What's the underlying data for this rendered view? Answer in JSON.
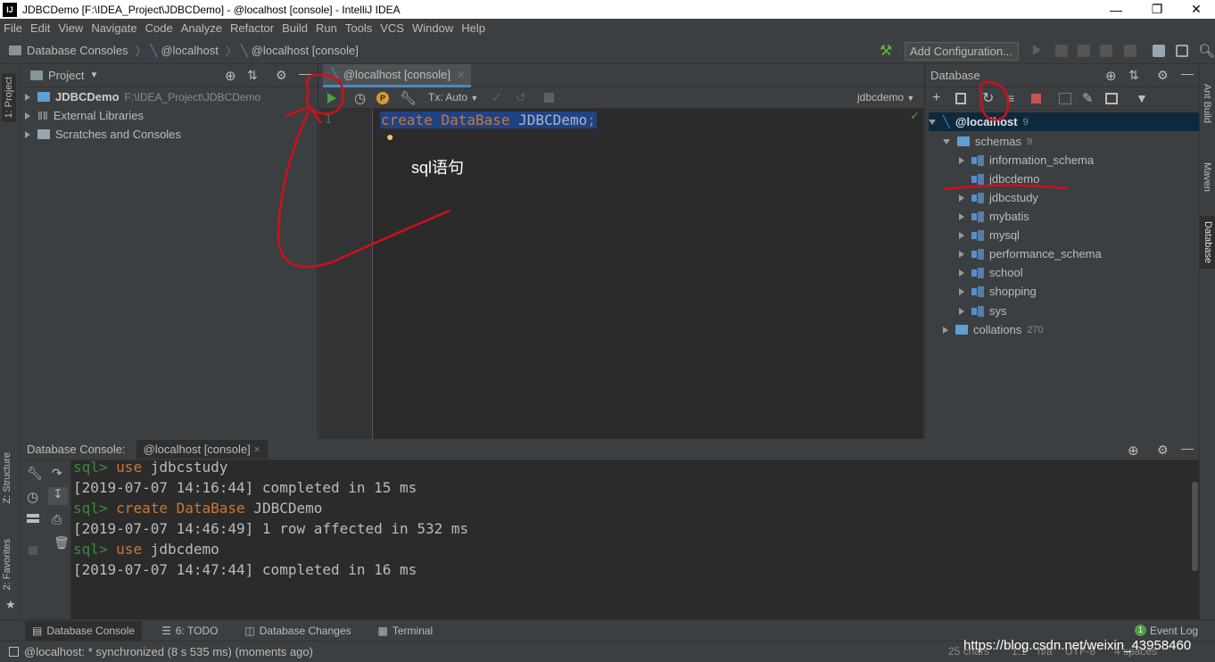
{
  "window": {
    "title": "JDBCDemo [F:\\IDEA_Project\\JDBCDemo] - @localhost [console] - IntelliJ IDEA",
    "app_icon": "IJ"
  },
  "menu": [
    "File",
    "Edit",
    "View",
    "Navigate",
    "Code",
    "Analyze",
    "Refactor",
    "Build",
    "Run",
    "Tools",
    "VCS",
    "Window",
    "Help"
  ],
  "breadcrumb": [
    "Database Consoles",
    "@localhost",
    "@localhost [console]"
  ],
  "toolbar": {
    "add_config": "Add Configuration..."
  },
  "left_tabs": {
    "project": "1: Project",
    "structure": "Z: Structure",
    "favorites": "2: Favorites"
  },
  "right_tabs": {
    "ant": "Ant Build",
    "maven": "Maven",
    "database": "Database"
  },
  "project_panel": {
    "title": "Project",
    "items": [
      {
        "label": "JDBCDemo",
        "path": "F:\\IDEA_Project\\JDBCDemo"
      },
      {
        "label": "External Libraries"
      },
      {
        "label": "Scratches and Consoles"
      }
    ]
  },
  "editor": {
    "tab": "@localhost [console]",
    "tx_mode": "Tx: Auto",
    "schema": "jdbcdemo",
    "line_number": "1",
    "code_kw1": "create",
    "code_kw2": "DataBase",
    "code_ident": "JDBCDemo",
    "code_semi": ";",
    "annotation": "sql语句"
  },
  "database_panel": {
    "title": "Database",
    "root": {
      "label": "@localhost",
      "count": "9"
    },
    "schemas_label": "schemas",
    "schemas_count": "9",
    "schemas": [
      "information_schema",
      "jdbcdemo",
      "jdbcstudy",
      "mybatis",
      "mysql",
      "performance_schema",
      "school",
      "shopping",
      "sys"
    ],
    "collations_label": "collations",
    "collations_count": "270"
  },
  "console": {
    "header_label": "Database Console:",
    "header_tab": "@localhost [console]",
    "lines": [
      {
        "prompt": "sql>",
        "kw": "use",
        "rest": " jdbcstudy"
      },
      {
        "text": "[2019-07-07 14:16:44] completed in 15 ms"
      },
      {
        "prompt": "sql>",
        "kw": "create DataBase",
        "rest": " JDBCDemo"
      },
      {
        "text": "[2019-07-07 14:46:49] 1 row affected in 532 ms"
      },
      {
        "prompt": "sql>",
        "kw": "use",
        "rest": " jdbcdemo"
      },
      {
        "text": "[2019-07-07 14:47:44] completed in 16 ms"
      }
    ]
  },
  "bottom_tabs": [
    "Database Console",
    "6: TODO",
    "Database Changes",
    "Terminal"
  ],
  "event_log": {
    "count": "1",
    "label": "Event Log"
  },
  "status": {
    "message": "@localhost: * synchronized (8 s 535 ms) (moments ago)",
    "chars": "25 chars",
    "pos": "1:1",
    "na": "n/a",
    "encoding": "UTF-8",
    "indent": "4 spaces",
    "watermark": "https://blog.csdn.net/weixin_43958460"
  }
}
